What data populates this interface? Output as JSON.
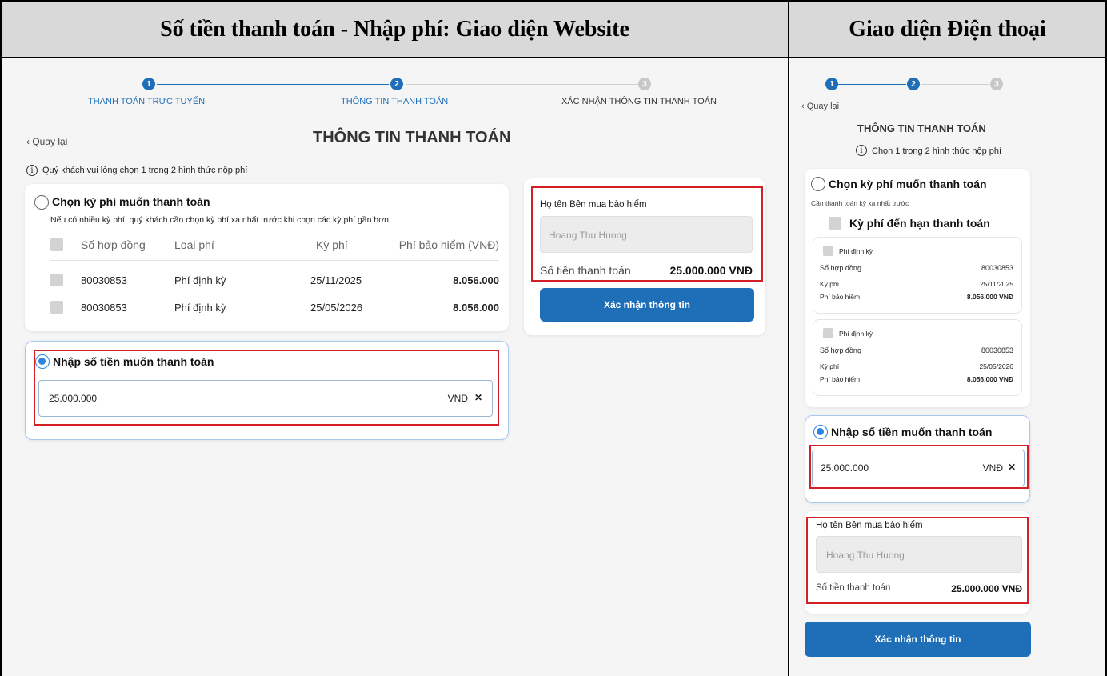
{
  "headers": {
    "web": "Số tiền thanh toán - Nhập phí: Giao diện Website",
    "mobile": "Giao diện Điện thoại"
  },
  "stepper": {
    "steps": [
      {
        "num": "1",
        "label": "THANH TOÁN TRỰC TUYẾN"
      },
      {
        "num": "2",
        "label": "THÔNG TIN THANH TOÁN"
      },
      {
        "num": "3",
        "label": "XÁC NHẬN THÔNG TIN THANH TOÁN"
      }
    ]
  },
  "web": {
    "back": "Quay lại",
    "title": "THÔNG TIN THANH TOÁN",
    "notice": "Quý khách vui lòng chọn 1 trong 2 hình thức nộp phí",
    "option1": {
      "title": "Chọn kỳ phí muốn thanh toán",
      "hint": "Nếu có nhiều kỳ phí, quý khách cần chọn kỳ phí xa nhất trước khi chọn các kỳ phí gần hơn",
      "columns": [
        "Số hợp đồng",
        "Loại phí",
        "Kỳ phí",
        "Phí bảo hiểm (VNĐ)"
      ],
      "rows": [
        [
          "80030853",
          "Phí định kỳ",
          "25/11/2025",
          "8.056.000"
        ],
        [
          "80030853",
          "Phí định kỳ",
          "25/05/2026",
          "8.056.000"
        ]
      ]
    },
    "option2": {
      "title": "Nhập số tiền muốn thanh toán",
      "value": "25.000.000",
      "currency": "VNĐ",
      "clear": "✕"
    },
    "summary": {
      "buyer_label": "Họ tên Bên mua bảo hiểm",
      "buyer_value": "Hoang Thu Huong",
      "amount_label": "Số tiền thanh toán",
      "amount_value": "25.000.000 VNĐ",
      "confirm": "Xác nhận thông tin"
    }
  },
  "mobile": {
    "steps": [
      "1",
      "2",
      "3"
    ],
    "back": "Quay lại",
    "title": "THÔNG TIN THANH TOÁN",
    "notice": "Chọn 1 trong 2 hình thức nộp phí",
    "option1": {
      "title": "Chọn kỳ phí muốn thanh toán",
      "hint": "Cần thanh toán kỳ xa nhất trước",
      "group_label": "Kỳ phí đến hạn thanh toán",
      "items": [
        {
          "type": "Phí định kỳ",
          "contract_label": "Số hợp đồng",
          "contract": "80030853",
          "period_label": "Kỳ phí",
          "period": "25/11/2025",
          "premium_label": "Phí bảo hiểm",
          "premium": "8.056.000 VNĐ"
        },
        {
          "type": "Phí định kỳ",
          "contract_label": "Số hợp đồng",
          "contract": "80030853",
          "period_label": "Kỳ phí",
          "period": "25/05/2026",
          "premium_label": "Phí bảo hiểm",
          "premium": "8.056.000 VNĐ"
        }
      ]
    },
    "option2": {
      "title": "Nhập số tiền muốn thanh toán",
      "value": "25.000.000",
      "currency": "VNĐ",
      "clear": "✕"
    },
    "summary": {
      "buyer_label": "Họ tên Bên mua bảo hiểm",
      "buyer_value": "Hoang Thu Huong",
      "amount_label": "Số tiền thanh toán",
      "amount_value": "25.000.000 VNĐ",
      "confirm": "Xác nhận thông tin"
    }
  },
  "colors": {
    "primary": "#1e6fb8",
    "highlight": "#d31f26",
    "radio": "#2a86e0"
  }
}
